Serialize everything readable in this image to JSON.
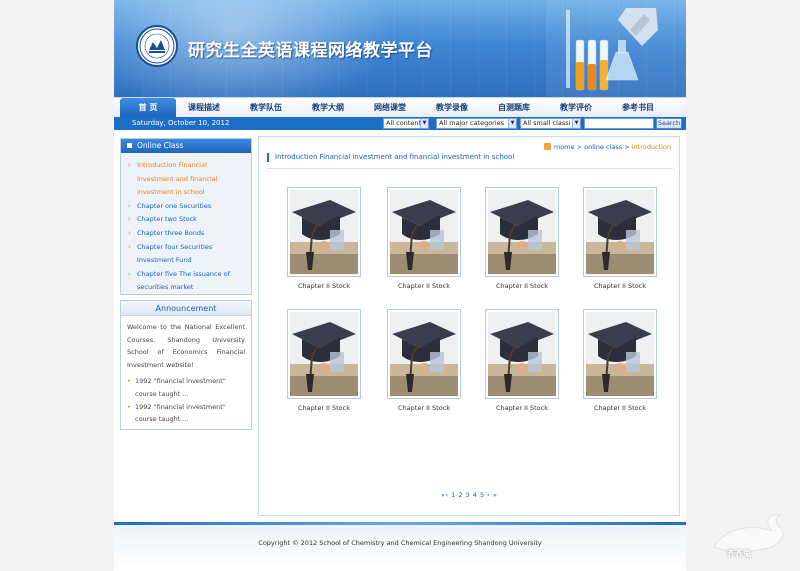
{
  "site": {
    "title": "研究生全英语课程网络教学平台",
    "logo_label": "SHANDONG UNIVERSITY"
  },
  "nav": {
    "items": [
      "首 页",
      "课程描述",
      "教学队伍",
      "教学大纲",
      "网络课堂",
      "教学录像",
      "自测题库",
      "教学评价",
      "参考书目"
    ],
    "active_index": 0
  },
  "toolbar": {
    "date": "Saturday, October 10, 2012",
    "filter_content": "All content",
    "filter_major": "All major categories",
    "filter_small": "All small classi",
    "search_value": "",
    "search_label": "Search"
  },
  "sidebar": {
    "online_title": "Online Class",
    "items": [
      "Introduction  Financial investment and financial investment in school",
      "Chapter one  Securities",
      "Chapter two  Stock",
      "Chapter three  Bonds",
      "Chapter four  Securities Investment Fund",
      "Chapter five  The issuance of securities market"
    ],
    "current_index": 0,
    "announcement_title": "Announcement",
    "announcement_text": "Welcome to the National Excellent Courses, Shandong University School of Economics Financial Investment website!",
    "announcement_items": [
      "1992 \"financial investment\" course taught ...",
      "1992 \"financial investment\" course taught ..."
    ]
  },
  "main": {
    "breadcrumb_home": "mome",
    "breadcrumb_mid": "online class",
    "breadcrumb_current": "introduction",
    "title": "Introduction  Financial investment and financial investment in school",
    "thumbs": [
      "Chapter II Stock",
      "Chapter II Stock",
      "Chapter II Stock",
      "Chapter II Stock",
      "Chapter II Stock",
      "Chapter II Stock",
      "Chapter II Stock",
      "Chapter II Stock"
    ],
    "pager": "«‹ 1 2 3 4 5 › »"
  },
  "footer": {
    "copyright": "Copyright © 2012  School of Chemistry and Chemical Engineering Shandong University"
  },
  "watermark": {
    "text": "齐齐兔"
  },
  "colors": {
    "brand_blue": "#1b6fc7",
    "link_blue": "#1a5fb4",
    "accent_orange": "#ee7d10"
  }
}
